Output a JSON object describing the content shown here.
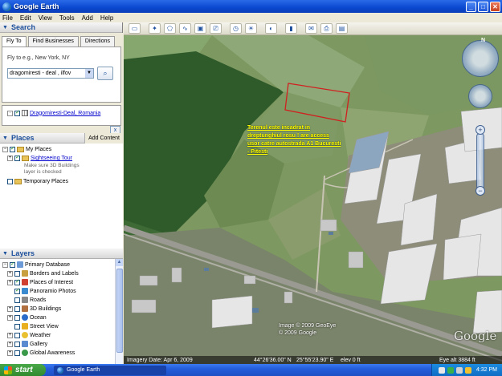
{
  "window": {
    "title": "Google Earth",
    "minimize": "_",
    "maximize": "□",
    "close": "✕"
  },
  "menu": [
    "File",
    "Edit",
    "View",
    "Tools",
    "Add",
    "Help"
  ],
  "search": {
    "header": "Search",
    "tabs": [
      "Fly To",
      "Find Businesses",
      "Directions"
    ],
    "fly_hint": "Fly to e.g., New York, NY",
    "fly_value": "dragomiresti - deal , ilfov",
    "result": "Dragomiresti-Deal, Romania",
    "close_label": "x"
  },
  "places": {
    "header": "Places",
    "add_content": "Add Content",
    "items": [
      {
        "label": "My Places"
      },
      {
        "label": "Sightseeing Tour",
        "note1": "Make sure 3D Buildings",
        "note2": "layer is checked"
      },
      {
        "label": "Temporary Places"
      }
    ]
  },
  "layers": {
    "header": "Layers",
    "items": [
      {
        "label": "Primary Database",
        "color": "#6b9ad6"
      },
      {
        "label": "Borders and Labels",
        "color": "#c8a040"
      },
      {
        "label": "Places of Interest",
        "color": "#d04030"
      },
      {
        "label": "Panoramio Photos",
        "color": "#3a8ad0"
      },
      {
        "label": "Roads",
        "color": "#888888"
      },
      {
        "label": "3D Buildings",
        "color": "#b07040"
      },
      {
        "label": "Ocean",
        "color": "#2a6ac8"
      },
      {
        "label": "Street View",
        "color": "#e8b020"
      },
      {
        "label": "Weather",
        "color": "#5aa0e0"
      },
      {
        "label": "Gallery",
        "color": "#5a8ad0"
      },
      {
        "label": "Global Awareness",
        "color": "#3a9a4a"
      }
    ]
  },
  "map": {
    "annotation": [
      "Terenul este incadrat in",
      "dreptunghiul rosu ! are access",
      "usor catre autostrada A1 Bucuresti",
      "- Pitesti"
    ],
    "copyright": [
      "Image © 2009 GeoEye",
      "© 2009 Google"
    ],
    "google_logo": "Google",
    "compass_n": "N",
    "status": {
      "imagery_date": "Imagery Date: Apr 6, 2009",
      "lat": "44°26'36.00\" N",
      "lon": "25°55'23.90\" E",
      "elev": "elev   0 ft",
      "eye_alt": "Eye alt   3884 ft"
    }
  },
  "taskbar": {
    "start": "start",
    "task": "Google Earth",
    "clock": "4:32 PM"
  }
}
